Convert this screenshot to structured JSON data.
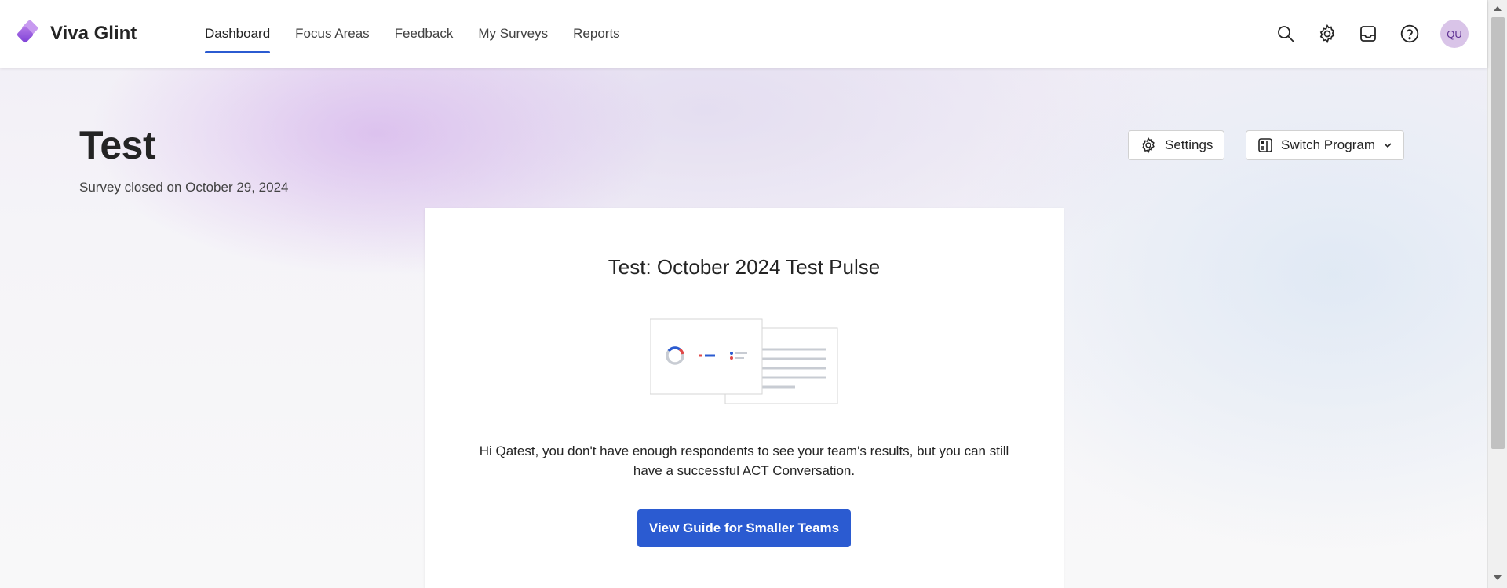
{
  "app": {
    "name": "Viva Glint",
    "logo_icon": "viva-glint-logo"
  },
  "nav": {
    "items": [
      {
        "label": "Dashboard",
        "active": true
      },
      {
        "label": "Focus Areas",
        "active": false
      },
      {
        "label": "Feedback",
        "active": false
      },
      {
        "label": "My Surveys",
        "active": false
      },
      {
        "label": "Reports",
        "active": false
      }
    ],
    "accent_color": "#2b5bd1"
  },
  "header_icons": [
    "search-icon",
    "gear-icon",
    "inbox-icon",
    "help-icon"
  ],
  "user": {
    "initials": "QU",
    "avatar_color": "#d9c4e8"
  },
  "page": {
    "title": "Test",
    "subtitle": "Survey closed on October 29, 2024",
    "settings_label": "Settings",
    "switch_program_label": "Switch Program"
  },
  "card": {
    "title": "Test: October 2024 Test Pulse",
    "message": "Hi Qatest, you don't have enough respondents to see your team's results, but you can still have a successful ACT Conversation.",
    "button_label": "View Guide for Smaller Teams",
    "button_color": "#2b5bd1"
  }
}
